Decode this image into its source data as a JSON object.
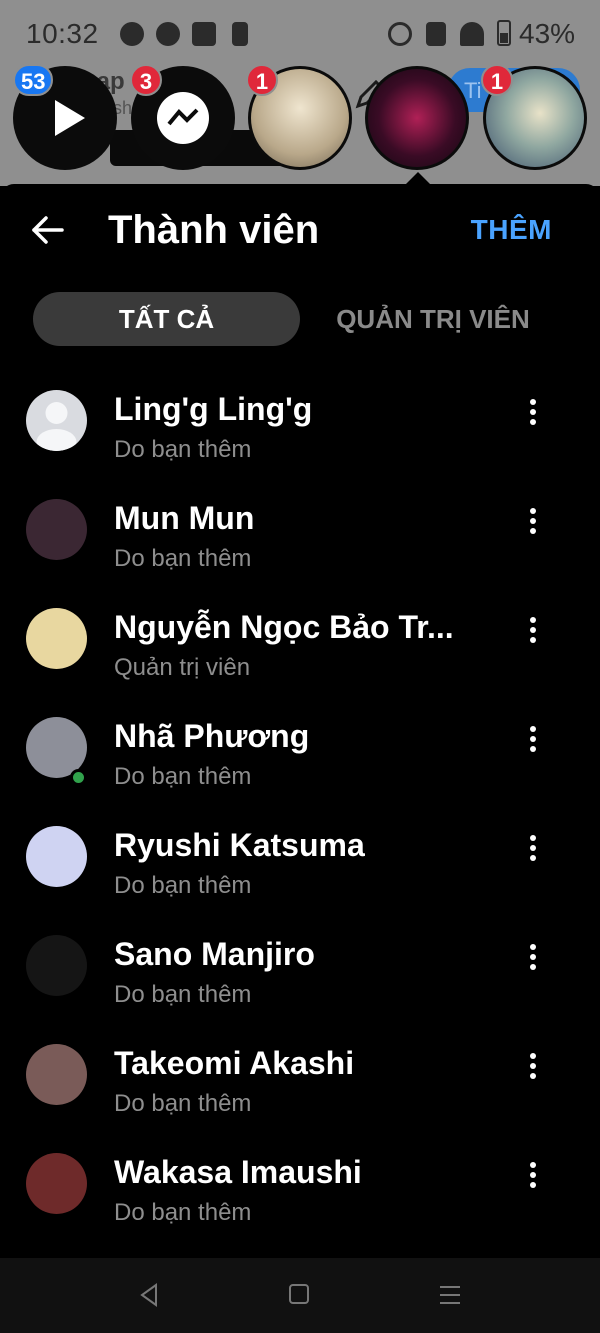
{
  "status_bar": {
    "time": "10:32",
    "battery": "43%"
  },
  "background": {
    "title_fragment": "hap",
    "subtitle_fragment": "sh",
    "pill_text": "Ti",
    "badges": [
      "53",
      "3",
      "1",
      "1"
    ]
  },
  "sheet": {
    "title": "Thành viên",
    "add_label": "THÊM",
    "tabs": [
      {
        "label": "TẤT CẢ",
        "active": true
      },
      {
        "label": "QUẢN TRỊ VIÊN",
        "active": false
      }
    ]
  },
  "members": [
    {
      "name": "Ling'g Ling'g",
      "role": "Do bạn thêm",
      "online": false,
      "avatar_color": "#d9dbe0"
    },
    {
      "name": "Mun Mun",
      "role": "Do bạn thêm",
      "online": false,
      "avatar_color": "#3b2733"
    },
    {
      "name": "Nguyễn Ngọc Bảo Tr...",
      "role": "Quản trị viên",
      "online": false,
      "avatar_color": "#e8d7a0"
    },
    {
      "name": "Nhã Phương",
      "role": "Do bạn thêm",
      "online": true,
      "avatar_color": "#8d8f99"
    },
    {
      "name": "Ryushi Katsuma",
      "role": "Do bạn thêm",
      "online": false,
      "avatar_color": "#cfd3f2"
    },
    {
      "name": "Sano Manjiro",
      "role": "Do bạn thêm",
      "online": false,
      "avatar_color": "#151515"
    },
    {
      "name": "Takeomi Akashi",
      "role": "Do bạn thêm",
      "online": false,
      "avatar_color": "#7a5b58"
    },
    {
      "name": "Wakasa Imaushi",
      "role": "Do bạn thêm",
      "online": false,
      "avatar_color": "#6e2a2a"
    }
  ],
  "icons": {
    "back": "arrow-left-icon",
    "more": "more-vertical-icon",
    "nav_back": "nav-back-icon",
    "nav_home": "nav-home-icon",
    "nav_recents": "nav-recents-icon"
  },
  "colors": {
    "accent": "#4aa3ff",
    "badge_red": "#e0283a",
    "badge_blue": "#1877f2",
    "online": "#31a24c"
  }
}
